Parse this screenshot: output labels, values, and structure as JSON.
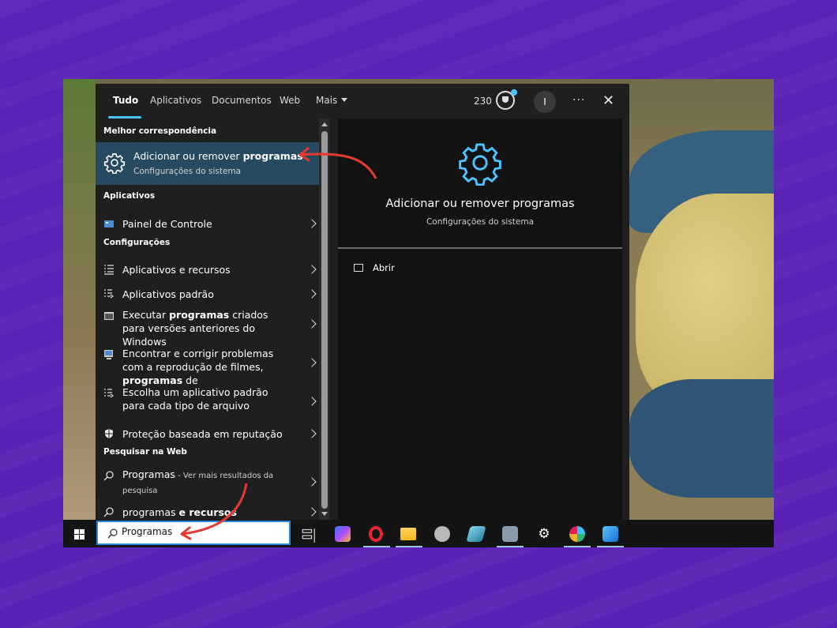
{
  "tabs": [
    {
      "label": "Tudo",
      "active": true
    },
    {
      "label": "Aplicativos"
    },
    {
      "label": "Documentos"
    },
    {
      "label": "Web"
    },
    {
      "label": "Mais"
    }
  ],
  "header": {
    "points": "230",
    "avatar_initial": "I",
    "more": "···",
    "close": "✕"
  },
  "sections": {
    "best_match": "Melhor correspondência",
    "apps": "Aplicativos",
    "settings": "Configurações",
    "web": "Pesquisar na Web"
  },
  "best_match": {
    "title_plain": "Adicionar ou remover ",
    "title_bold": "programas",
    "subtitle": "Configurações do sistema",
    "icon": "gear-icon"
  },
  "apps": [
    {
      "label": "Painel de Controle",
      "icon": "control-panel-icon"
    }
  ],
  "settings": [
    {
      "parts": [
        "Aplicativos e recursos"
      ],
      "icon": "apps-list-icon"
    },
    {
      "parts": [
        "Aplicativos padrão"
      ],
      "icon": "default-apps-icon"
    },
    {
      "parts": [
        "Executar ",
        "programas",
        " criados para versões anteriores do Windows"
      ],
      "icon": "compatibility-icon"
    },
    {
      "parts": [
        "Encontrar e corrigir problemas com a reprodução de filmes, ",
        "programas",
        " de"
      ],
      "icon": "troubleshoot-icon"
    },
    {
      "parts": [
        "Escolha um aplicativo padrão para cada tipo de arquivo"
      ],
      "icon": "default-apps-icon"
    },
    {
      "parts": [
        "Proteção baseada em reputação"
      ],
      "icon": "shield-icon"
    }
  ],
  "web": [
    {
      "label": "Programas",
      "suffix": " - Ver mais resultados da pesquisa",
      "icon": "search-icon"
    },
    {
      "label": "programas ",
      "bold": "e recursos",
      "icon": "search-icon"
    }
  ],
  "details": {
    "title": "Adicionar ou remover programas",
    "subtitle": "Configurações do sistema",
    "open_label": "Abrir",
    "icon": "gear-icon"
  },
  "taskbar": {
    "search_value": "Programas",
    "apps": [
      "task-view-icon",
      "copilot-icon",
      "opera-icon",
      "file-explorer-icon",
      "app-icon",
      "app-icon",
      "app-icon",
      "settings-icon",
      "slack-icon",
      "photos-icon"
    ]
  },
  "colors": {
    "accent": "#4cc2ff",
    "highlight": "#264a5f",
    "annotation": "#e53935",
    "background": "#5b22b8"
  }
}
